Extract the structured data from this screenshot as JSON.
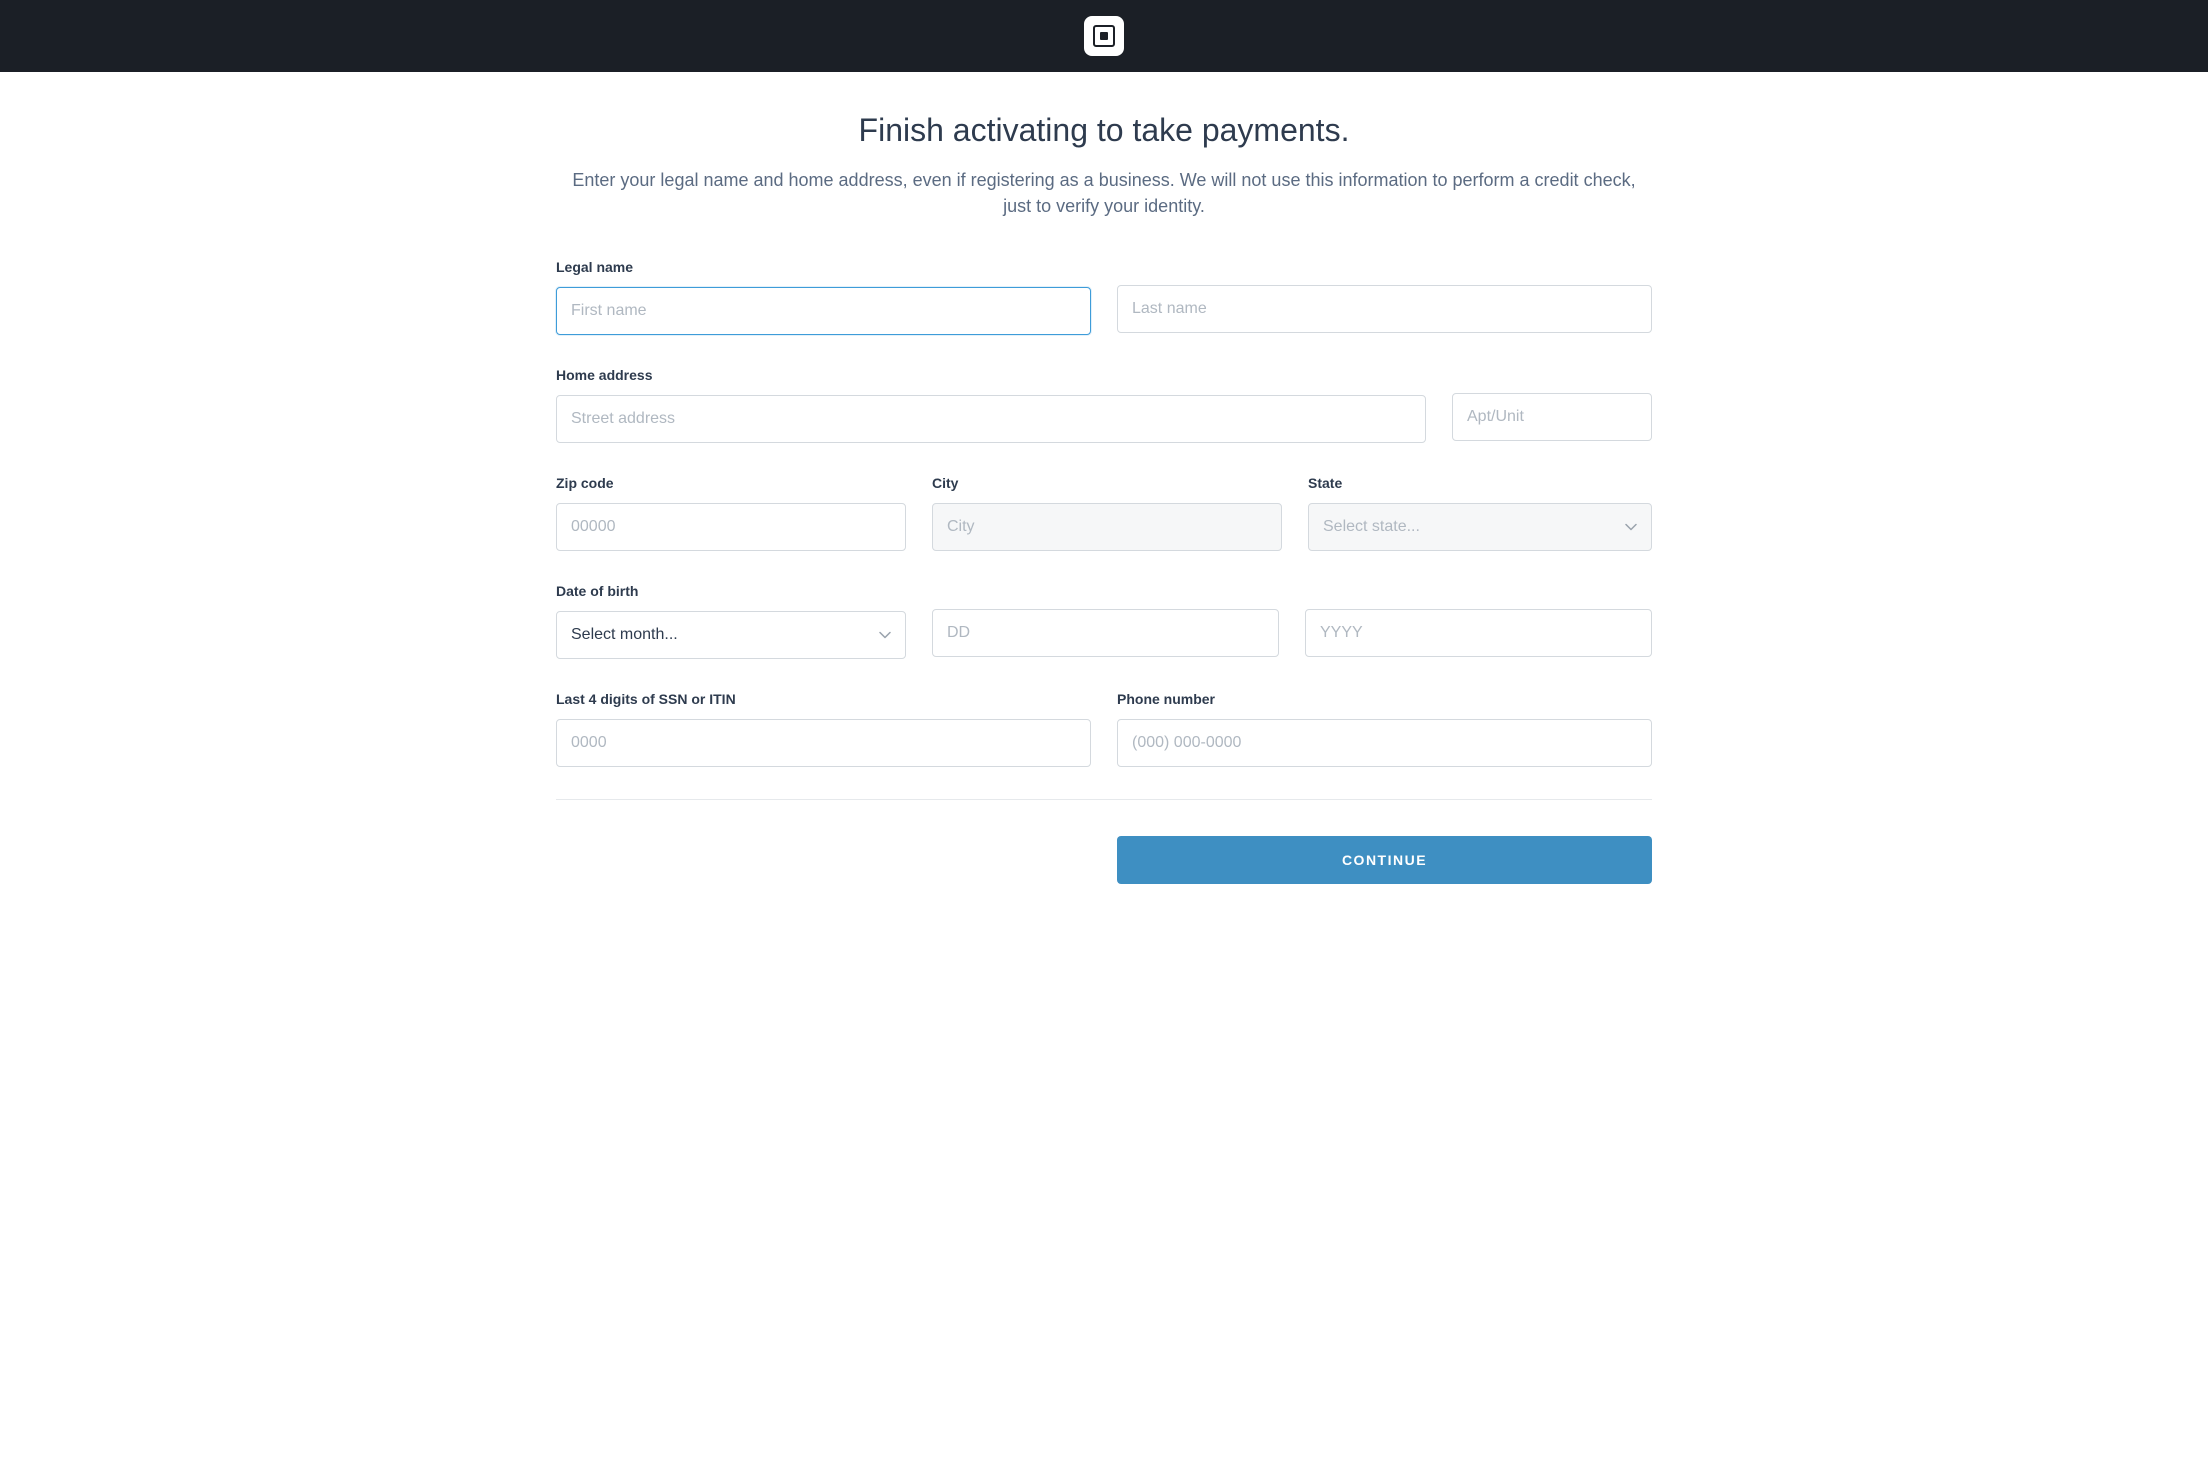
{
  "header": {
    "logo_name": "square-logo"
  },
  "page": {
    "title": "Finish activating to take payments.",
    "subtitle": "Enter your legal name and home address, even if registering as a business. We will not use this information to perform a credit check, just to verify your identity."
  },
  "form": {
    "legal_name": {
      "label": "Legal name",
      "first_placeholder": "First name",
      "last_placeholder": "Last name",
      "first_value": "",
      "last_value": ""
    },
    "home_address": {
      "label": "Home address",
      "street_placeholder": "Street address",
      "apt_placeholder": "Apt/Unit",
      "street_value": "",
      "apt_value": ""
    },
    "zip": {
      "label": "Zip code",
      "placeholder": "00000",
      "value": ""
    },
    "city": {
      "label": "City",
      "placeholder": "City",
      "value": ""
    },
    "state": {
      "label": "State",
      "placeholder": "Select state...",
      "value": ""
    },
    "dob": {
      "label": "Date of birth",
      "month_placeholder": "Select month...",
      "month_value": "",
      "day_placeholder": "DD",
      "day_value": "",
      "year_placeholder": "YYYY",
      "year_value": ""
    },
    "ssn": {
      "label": "Last 4 digits of SSN or ITIN",
      "placeholder": "0000",
      "value": ""
    },
    "phone": {
      "label": "Phone number",
      "placeholder": "(000) 000-0000",
      "value": ""
    }
  },
  "actions": {
    "continue_label": "CONTINUE"
  }
}
